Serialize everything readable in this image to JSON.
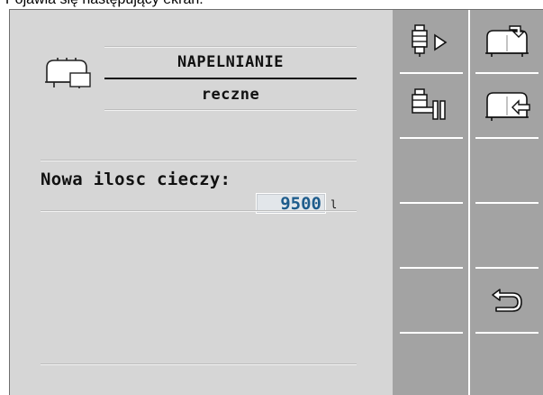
{
  "caption": "Pojawia się następujący ekran:",
  "screen": {
    "title": "NAPELNIANIE",
    "subtitle": "reczne",
    "field_label": "Nowa ilosc cieczy:",
    "field_value": "9500",
    "field_unit": "l"
  },
  "softkeys": [
    {
      "name": "fill-valve-start-button",
      "icon": "valve-play-icon"
    },
    {
      "name": "tank-fill-top-button",
      "icon": "tank-fill-top-icon"
    },
    {
      "name": "fill-valve-pause-button",
      "icon": "valve-pause-icon"
    },
    {
      "name": "tank-fill-side-button",
      "icon": "tank-fill-side-icon"
    },
    {
      "name": "back-button",
      "icon": "back-arrow-icon"
    }
  ],
  "colors": {
    "screen_bg": "#d6d6d6",
    "panel_bg": "#a3a3a3",
    "value_text": "#1e5c8c"
  }
}
